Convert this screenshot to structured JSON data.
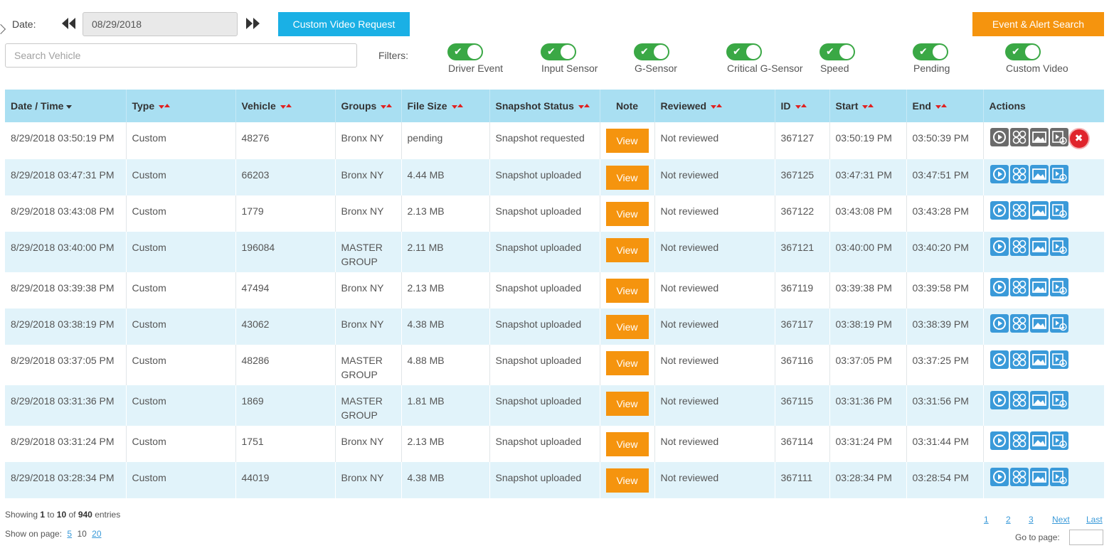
{
  "toolbar": {
    "date_label": "Date:",
    "date_value": "08/29/2018",
    "custom_video_request": "Custom Video Request",
    "event_alert_search": "Event & Alert Search",
    "search_placeholder": "Search Vehicle",
    "filters_label": "Filters:"
  },
  "filters": [
    {
      "label": "Driver Event",
      "on": true
    },
    {
      "label": "Input Sensor",
      "on": true
    },
    {
      "label": "G-Sensor",
      "on": true
    },
    {
      "label": "Critical G-Sensor",
      "on": true
    },
    {
      "label": "Speed",
      "on": true
    },
    {
      "label": "Pending",
      "on": true
    },
    {
      "label": "Custom Video",
      "on": true
    }
  ],
  "table": {
    "headers": [
      "Date / Time",
      "Type",
      "Vehicle",
      "Groups",
      "File Size",
      "Snapshot Status",
      "Note",
      "Reviewed",
      "ID",
      "Start",
      "End",
      "Actions"
    ],
    "view_label": "View",
    "rows": [
      {
        "datetime": "8/29/2018 03:50:19 PM",
        "type": "Custom",
        "vehicle": "48276",
        "group": "Bronx NY",
        "size": "pending",
        "status": "Snapshot requested",
        "reviewed": "Not reviewed",
        "id": "367127",
        "start": "03:50:19 PM",
        "end": "03:50:39 PM"
      },
      {
        "datetime": "8/29/2018 03:47:31 PM",
        "type": "Custom",
        "vehicle": "66203",
        "group": "Bronx NY",
        "size": "4.44 MB",
        "status": "Snapshot uploaded",
        "reviewed": "Not reviewed",
        "id": "367125",
        "start": "03:47:31 PM",
        "end": "03:47:51 PM"
      },
      {
        "datetime": "8/29/2018 03:43:08 PM",
        "type": "Custom",
        "vehicle": "1779",
        "group": "Bronx NY",
        "size": "2.13 MB",
        "status": "Snapshot uploaded",
        "reviewed": "Not reviewed",
        "id": "367122",
        "start": "03:43:08 PM",
        "end": "03:43:28 PM"
      },
      {
        "datetime": "8/29/2018 03:40:00 PM",
        "type": "Custom",
        "vehicle": "196084",
        "group": "MASTER GROUP",
        "size": "2.11 MB",
        "status": "Snapshot uploaded",
        "reviewed": "Not reviewed",
        "id": "367121",
        "start": "03:40:00 PM",
        "end": "03:40:20 PM"
      },
      {
        "datetime": "8/29/2018 03:39:38 PM",
        "type": "Custom",
        "vehicle": "47494",
        "group": "Bronx NY",
        "size": "2.13 MB",
        "status": "Snapshot uploaded",
        "reviewed": "Not reviewed",
        "id": "367119",
        "start": "03:39:38 PM",
        "end": "03:39:58 PM"
      },
      {
        "datetime": "8/29/2018 03:38:19 PM",
        "type": "Custom",
        "vehicle": "43062",
        "group": "Bronx NY",
        "size": "4.38 MB",
        "status": "Snapshot uploaded",
        "reviewed": "Not reviewed",
        "id": "367117",
        "start": "03:38:19 PM",
        "end": "03:38:39 PM"
      },
      {
        "datetime": "8/29/2018 03:37:05 PM",
        "type": "Custom",
        "vehicle": "48286",
        "group": "MASTER GROUP",
        "size": "4.88 MB",
        "status": "Snapshot uploaded",
        "reviewed": "Not reviewed",
        "id": "367116",
        "start": "03:37:05 PM",
        "end": "03:37:25 PM"
      },
      {
        "datetime": "8/29/2018 03:31:36 PM",
        "type": "Custom",
        "vehicle": "1869",
        "group": "MASTER GROUP",
        "size": "1.81 MB",
        "status": "Snapshot uploaded",
        "reviewed": "Not reviewed",
        "id": "367115",
        "start": "03:31:36 PM",
        "end": "03:31:56 PM"
      },
      {
        "datetime": "8/29/2018 03:31:24 PM",
        "type": "Custom",
        "vehicle": "1751",
        "group": "Bronx NY",
        "size": "2.13 MB",
        "status": "Snapshot uploaded",
        "reviewed": "Not reviewed",
        "id": "367114",
        "start": "03:31:24 PM",
        "end": "03:31:44 PM"
      },
      {
        "datetime": "8/29/2018 03:28:34 PM",
        "type": "Custom",
        "vehicle": "44019",
        "group": "Bronx NY",
        "size": "4.38 MB",
        "status": "Snapshot uploaded",
        "reviewed": "Not reviewed",
        "id": "367111",
        "start": "03:28:34 PM",
        "end": "03:28:54 PM"
      }
    ]
  },
  "footer": {
    "showing_prefix": "Showing",
    "showing_from": "1",
    "showing_to_word": "to",
    "showing_to": "10",
    "showing_of_word": "of",
    "showing_total": "940",
    "showing_suffix": "entries",
    "show_on_page_label": "Show on page:",
    "page_sizes": [
      "5",
      "10",
      "20"
    ],
    "pages": [
      "1",
      "2",
      "3"
    ],
    "next_label": "Next",
    "last_label": "Last",
    "goto_label": "Go to page:"
  },
  "colors": {
    "accent_blue": "#1ab0e5",
    "accent_orange": "#f5940e",
    "toggle_green": "#3aa845",
    "header_bg": "#a9dff2",
    "alt_row_bg": "#e1f3fa",
    "action_blue": "#3a9ad9",
    "action_gray": "#6b6b6b",
    "delete_red": "#e0242b",
    "sort_red": "#e02020"
  },
  "icons": {
    "prev": "double-chevron-left-icon",
    "next": "double-chevron-right-icon",
    "toggle_check": "checkmark-icon",
    "row_actions": [
      "play-icon",
      "multi-camera-icon",
      "image-icon",
      "video-download-icon"
    ],
    "row_delete": "close-icon"
  }
}
